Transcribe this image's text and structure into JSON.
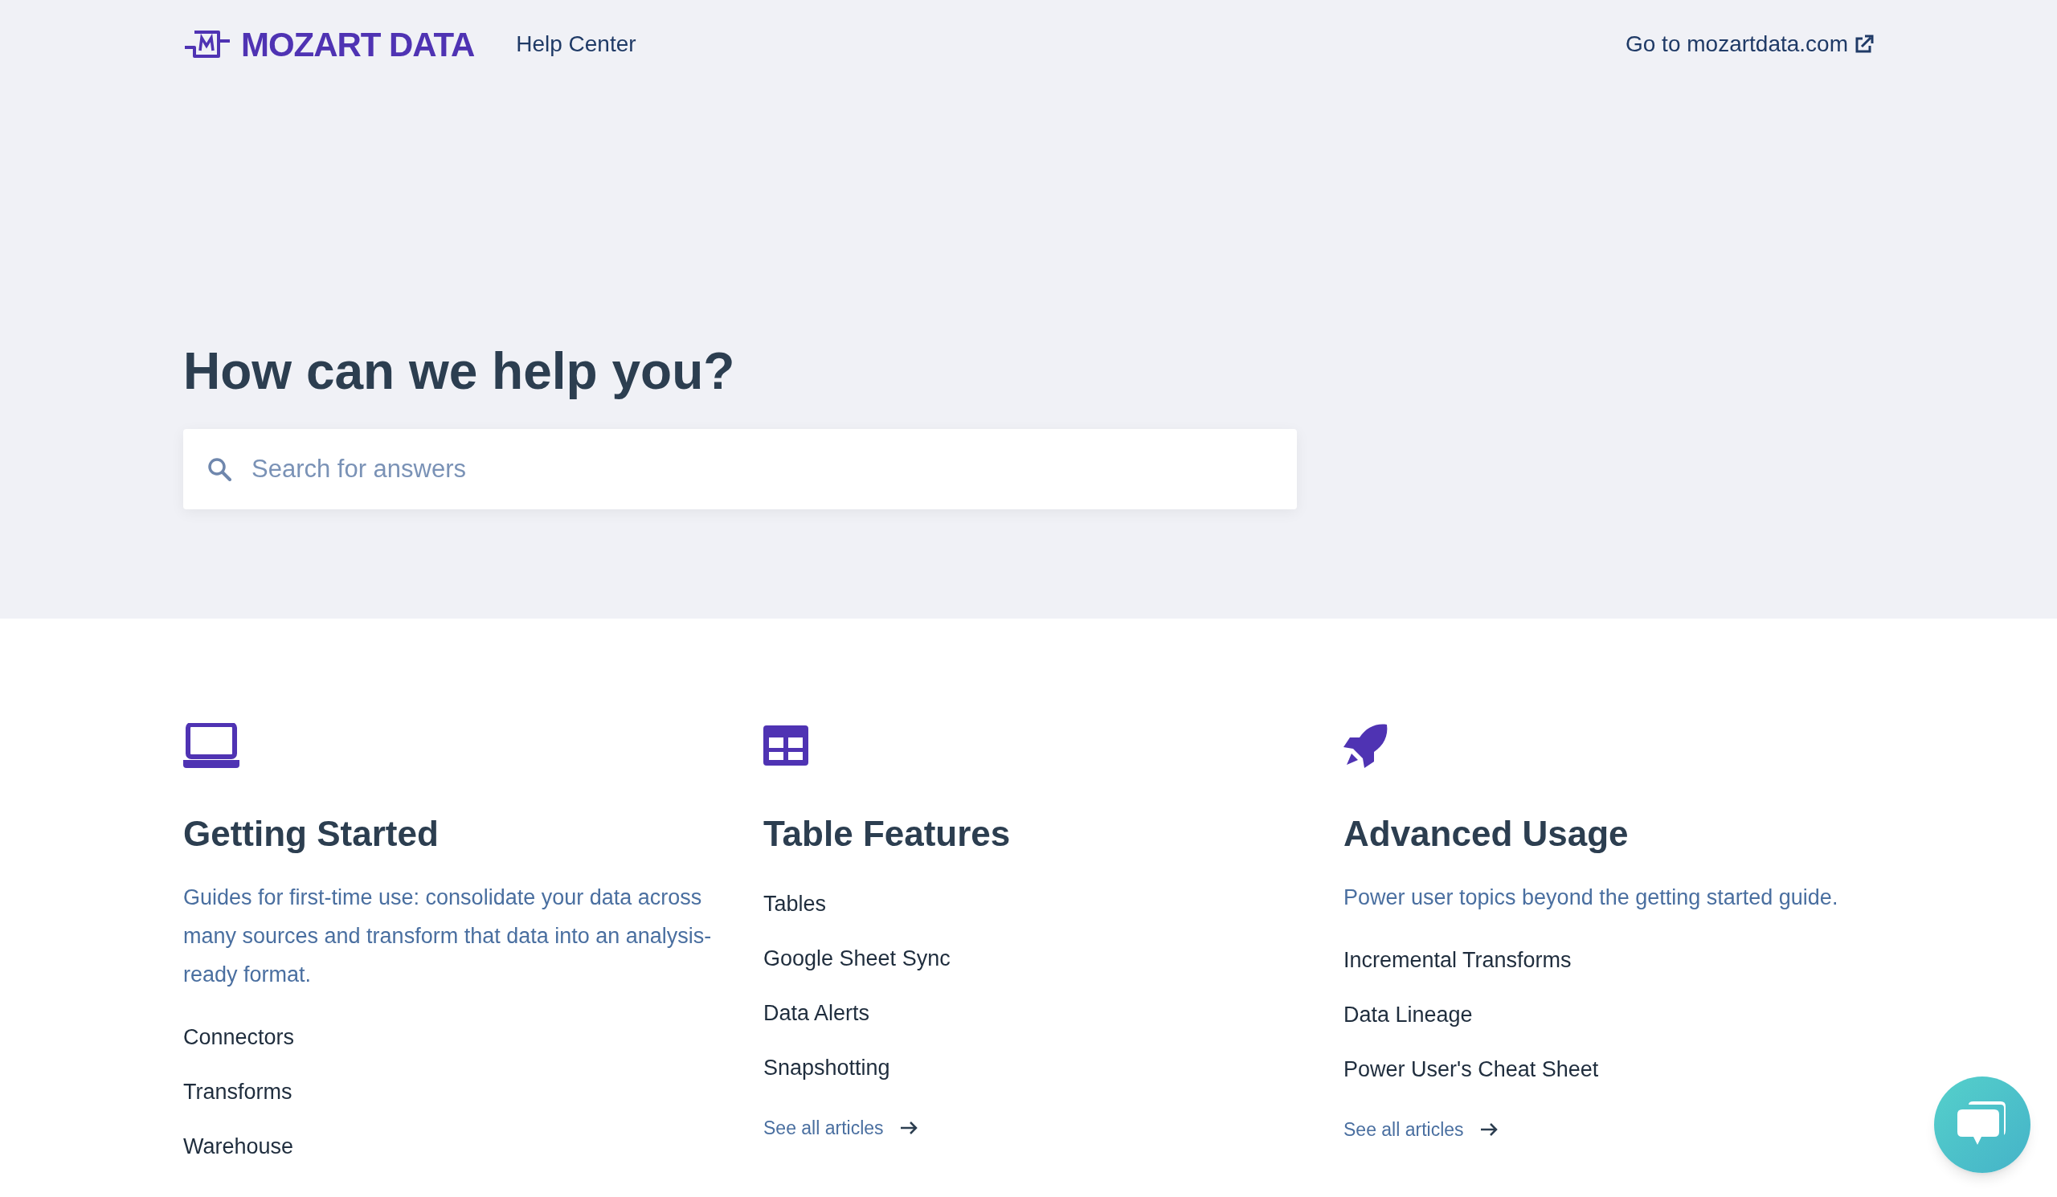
{
  "header": {
    "logo": "MOZART DATA",
    "title": "Help Center",
    "external_link": "Go to mozartdata.com"
  },
  "hero": {
    "heading": "How can we help you?",
    "search": {
      "placeholder": "Search for answers"
    }
  },
  "categories": [
    {
      "title": "Getting Started",
      "description": "Guides for first-time use: consolidate your data across many sources and transform that data into an analysis-ready format.",
      "articles": [
        "Connectors",
        "Transforms",
        "Warehouse"
      ]
    },
    {
      "title": "Table Features",
      "articles": [
        "Tables",
        "Google Sheet Sync",
        "Data Alerts",
        "Snapshotting"
      ],
      "see_all": "See all articles"
    },
    {
      "title": "Advanced Usage",
      "description": "Power user topics beyond the getting started guide.",
      "articles": [
        "Incremental Transforms",
        "Data Lineage",
        "Power User's Cheat Sheet"
      ],
      "see_all": "See all articles"
    }
  ]
}
